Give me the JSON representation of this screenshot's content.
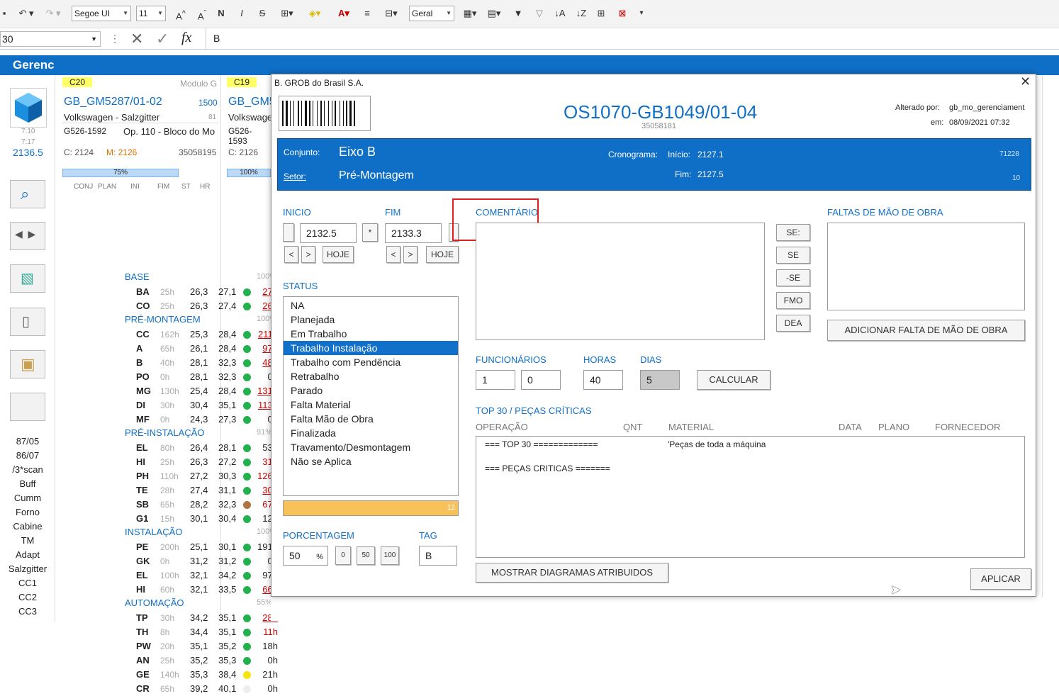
{
  "toolbar": {
    "font": "Segoe UI",
    "size": "11",
    "format": "Geral"
  },
  "formula": {
    "cellref": "30",
    "value": "B"
  },
  "sheet": {
    "title": "Gerenc"
  },
  "left": {
    "val_7_10": "7:10",
    "val_7_17": "7:17",
    "main_val": "2136.5",
    "items": [
      "87/05",
      "86/07",
      "/3*scan",
      "Buff",
      "Cumm",
      "Forno",
      "Cabine",
      "TM",
      "Adapt",
      "Salzgitter",
      "CC1",
      "CC2",
      "CC3"
    ]
  },
  "card1": {
    "code": "C20",
    "modulo": "Modulo G",
    "order": "GB_GM5287/01-02",
    "num": "1500",
    "client": "Volkswagen - Salzgitter",
    "cnum": "81",
    "part": "G526-1592",
    "op": "Op. 110 - Bloco do Mo",
    "c": "C: 2124",
    "m": "M: 2126",
    "id": "35058195",
    "pct": "75%",
    "headers": [
      "CONJ",
      "PLAN",
      "INI",
      "FIM",
      "ST",
      "HR"
    ]
  },
  "card2": {
    "code": "C19",
    "order": "GB_GM5",
    "client": "Volkswage",
    "part": "G526-1593",
    "c": "C: 2126",
    "pct": "100%"
  },
  "dialog": {
    "window_title": "B. GROB do Brasil S.A.",
    "os": "OS1070-GB1049/01-04",
    "os_sub": "35058181",
    "altered_by_label": "Alterado por:",
    "altered_by": "gb_mo_gerenciament",
    "em_label": "em:",
    "em": "08/09/2021 07:32",
    "conjunto_label": "Conjunto:",
    "conjunto": "Eixo B",
    "setor_label": "Setor:",
    "setor": "Pré-Montagem",
    "cronograma_label": "Cronograma:",
    "inicio_label": "Início:",
    "inicio": "2127.1",
    "fim_label": "Fim:",
    "fim": "2127.5",
    "n1": "71228",
    "n2": "10",
    "inicio_field_label": "INICIO",
    "inicio_value": "2132.5",
    "fim_field_label": "FIM",
    "fim_value": "2133.3",
    "hoje": "HOJE",
    "comentario_label": "COMENTÁRIO",
    "faltas_label": "FALTAS DE MÃO DE OBRA",
    "add_falta": "ADICIONAR FALTA DE MÃO DE OBRA",
    "se_buttons": [
      "SE:",
      "SE",
      "-SE",
      "FMO",
      "DEA"
    ],
    "status_label": "STATUS",
    "status": [
      "NA",
      "Planejada",
      "Em Trabalho",
      "Trabalho Instalação",
      "Trabalho com Pendência",
      "Retrabalho",
      "Parado",
      "Falta Material",
      "Falta Mão de Obra",
      "Finalizada",
      "Travamento/Desmontagem",
      "Não se Aplica"
    ],
    "status_selected": 3,
    "progress_value": "12",
    "progress_fraction": 1.0,
    "func_label": "FUNCIONÁRIOS",
    "func1": "1",
    "func2": "0",
    "horas_label": "HORAS",
    "horas": "40",
    "dias_label": "DIAS",
    "dias": "5",
    "calcular": "CALCULAR",
    "top30_label": "TOP 30 / PEÇAS CRÍTICAS",
    "cols": [
      "OPERAÇÃO",
      "QNT",
      "MATERIAL",
      "DATA",
      "PLANO",
      "FORNECEDOR"
    ],
    "top30_line1": "=== TOP 30 =============",
    "top30_mat": "'Peças de toda a máquina",
    "top30_line2": "=== PEÇAS CRITICAS =======",
    "porcentagem_label": "PORCENTAGEM",
    "porcentagem": "50",
    "pct_sign": "%",
    "pct_btns": [
      "0",
      "50",
      "100"
    ],
    "tag_label": "TAG",
    "tag": "B",
    "mostrar": "MOSTRAR DIAGRAMAS ATRIBUIDOS",
    "aplicar": "APLICAR"
  }
}
